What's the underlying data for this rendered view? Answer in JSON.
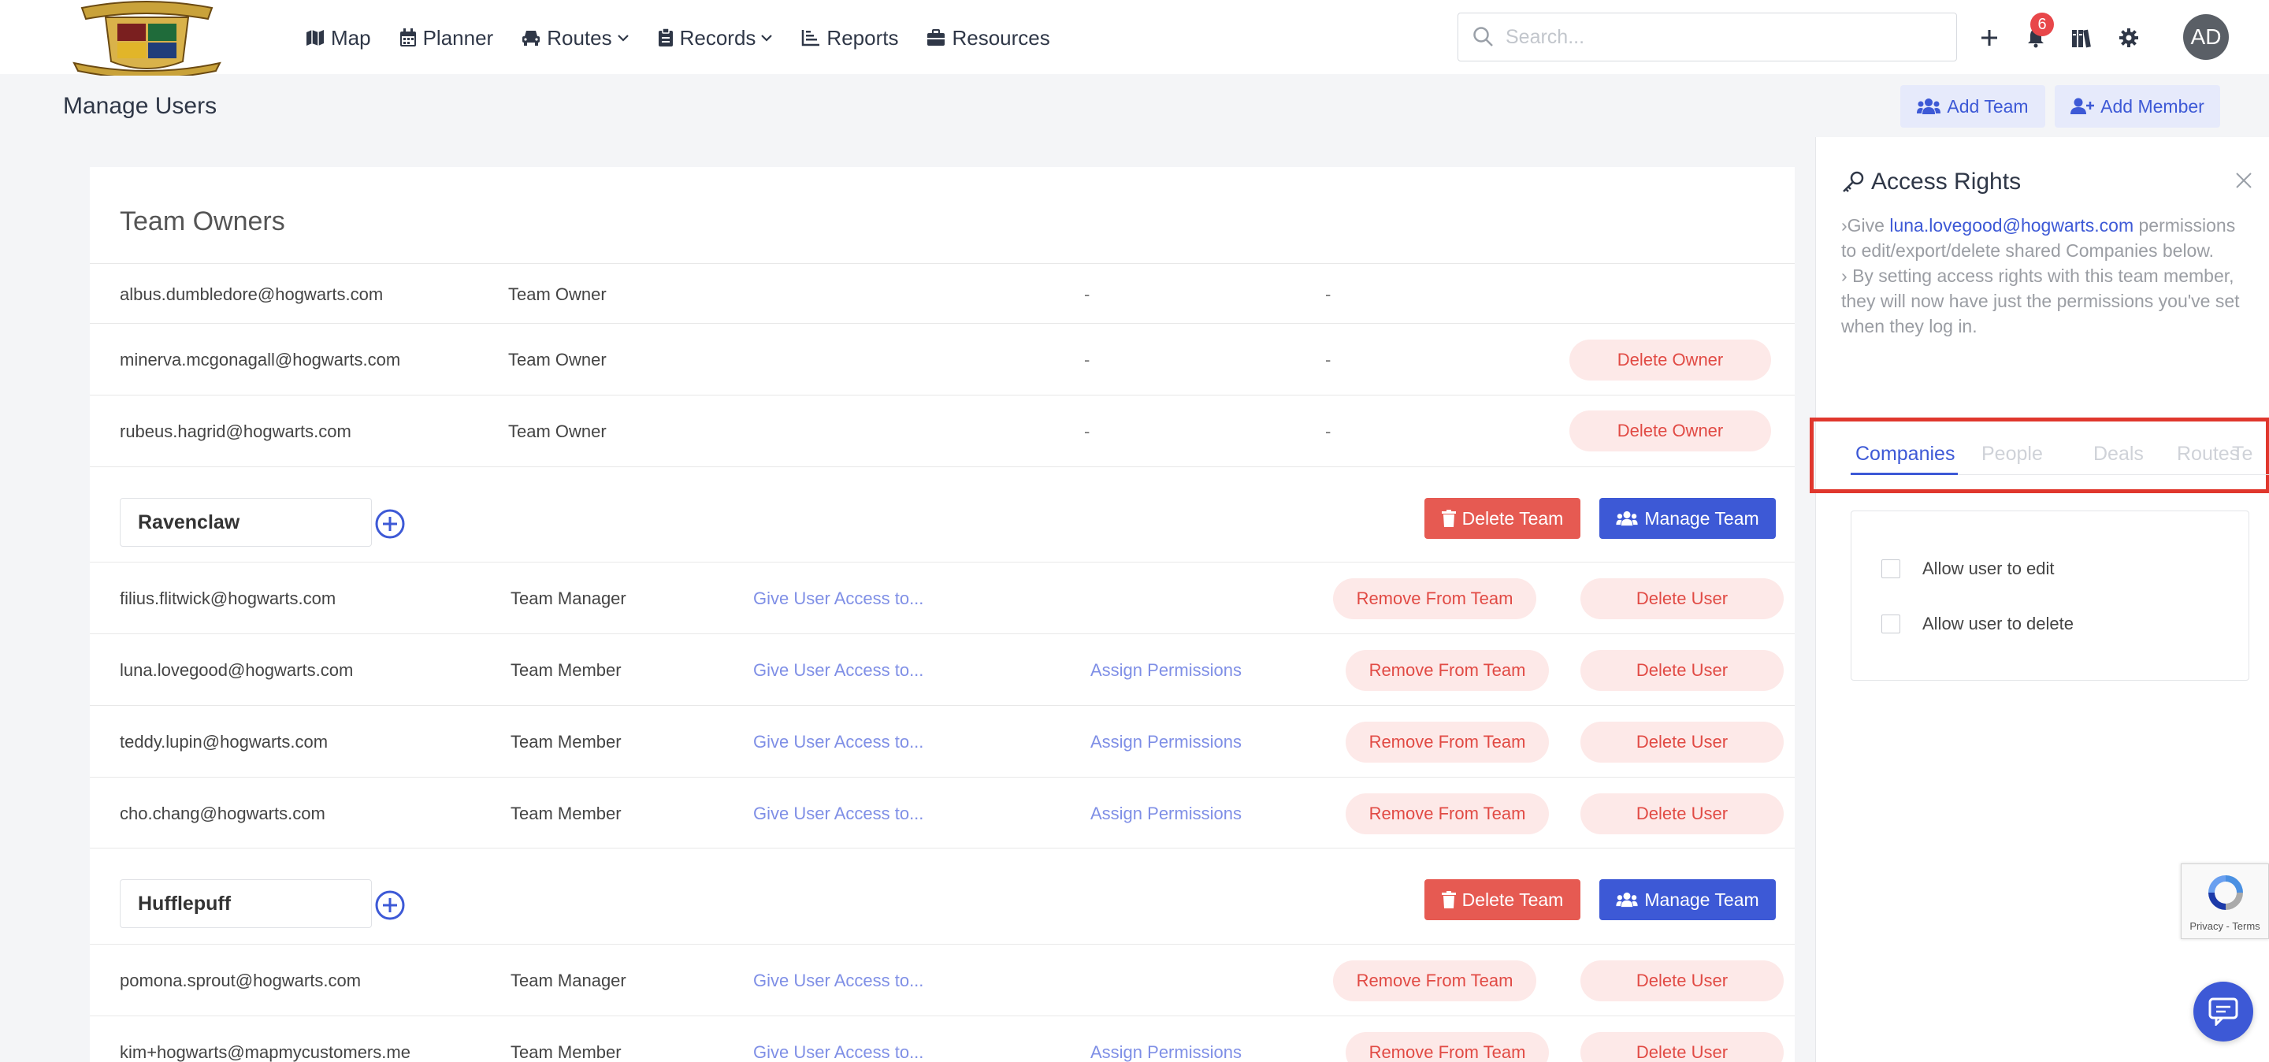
{
  "nav": {
    "items": [
      {
        "label": "Map",
        "icon": "map-icon"
      },
      {
        "label": "Planner",
        "icon": "calendar-icon"
      },
      {
        "label": "Routes",
        "icon": "car-icon",
        "dropdown": true
      },
      {
        "label": "Records",
        "icon": "clipboard-icon",
        "dropdown": true
      },
      {
        "label": "Reports",
        "icon": "chart-icon"
      },
      {
        "label": "Resources",
        "icon": "briefcase-icon"
      }
    ],
    "search_placeholder": "Search...",
    "notification_count": "6",
    "avatar_initials": "AD"
  },
  "header": {
    "title": "Manage Users",
    "add_team_label": "Add Team",
    "add_member_label": "Add Member"
  },
  "owners": {
    "title": "Team Owners",
    "rows": [
      {
        "email": "albus.dumbledore@hogwarts.com",
        "role": "Team Owner",
        "c1": "-",
        "c2": "-",
        "action": ""
      },
      {
        "email": "minerva.mcgonagall@hogwarts.com",
        "role": "Team Owner",
        "c1": "-",
        "c2": "-",
        "action": "Delete Owner"
      },
      {
        "email": "rubeus.hagrid@hogwarts.com",
        "role": "Team Owner",
        "c1": "-",
        "c2": "-",
        "action": "Delete Owner"
      }
    ]
  },
  "teams": [
    {
      "name": "Ravenclaw",
      "delete_label": "Delete Team",
      "manage_label": "Manage Team",
      "members": [
        {
          "email": "filius.flitwick@hogwarts.com",
          "role": "Team Manager",
          "access": "Give User Access to...",
          "assign": "",
          "remove": "Remove From Team",
          "delete": "Delete User"
        },
        {
          "email": "luna.lovegood@hogwarts.com",
          "role": "Team Member",
          "access": "Give User Access to...",
          "assign": "Assign Permissions",
          "remove": "Remove From Team",
          "delete": "Delete User"
        },
        {
          "email": "teddy.lupin@hogwarts.com",
          "role": "Team Member",
          "access": "Give User Access to...",
          "assign": "Assign Permissions",
          "remove": "Remove From Team",
          "delete": "Delete User"
        },
        {
          "email": "cho.chang@hogwarts.com",
          "role": "Team Member",
          "access": "Give User Access to...",
          "assign": "Assign Permissions",
          "remove": "Remove From Team",
          "delete": "Delete User"
        }
      ]
    },
    {
      "name": "Hufflepuff",
      "delete_label": "Delete Team",
      "manage_label": "Manage Team",
      "members": [
        {
          "email": "pomona.sprout@hogwarts.com",
          "role": "Team Manager",
          "access": "Give User Access to...",
          "assign": "",
          "remove": "Remove From Team",
          "delete": "Delete User"
        },
        {
          "email": "kim+hogwarts@mapmycustomers.me",
          "role": "Team Member",
          "access": "Give User Access to...",
          "assign": "Assign Permissions",
          "remove": "Remove From Team",
          "delete": "Delete User"
        }
      ]
    }
  ],
  "panel": {
    "title": "Access Rights",
    "desc_1_prefix": "Give ",
    "desc_1_email": "luna.lovegood@hogwarts.com",
    "desc_1_suffix": " permissions to edit/export/delete shared Companies below.",
    "desc_2": "By setting access rights with this team member, they will now have just the permissions you've set when they log in.",
    "tabs": [
      "Companies",
      "People",
      "Deals",
      "Routes",
      "Te"
    ],
    "active_tab": "Companies",
    "permissions": [
      {
        "label": "Allow user to edit",
        "checked": false
      },
      {
        "label": "Allow user to delete",
        "checked": false
      }
    ]
  },
  "recaptcha_text": "Privacy - Terms",
  "colors": {
    "primary": "#3d59d6",
    "danger": "#e65a52",
    "danger_light": "#fde9e8",
    "highlight_box": "#e0372d"
  }
}
